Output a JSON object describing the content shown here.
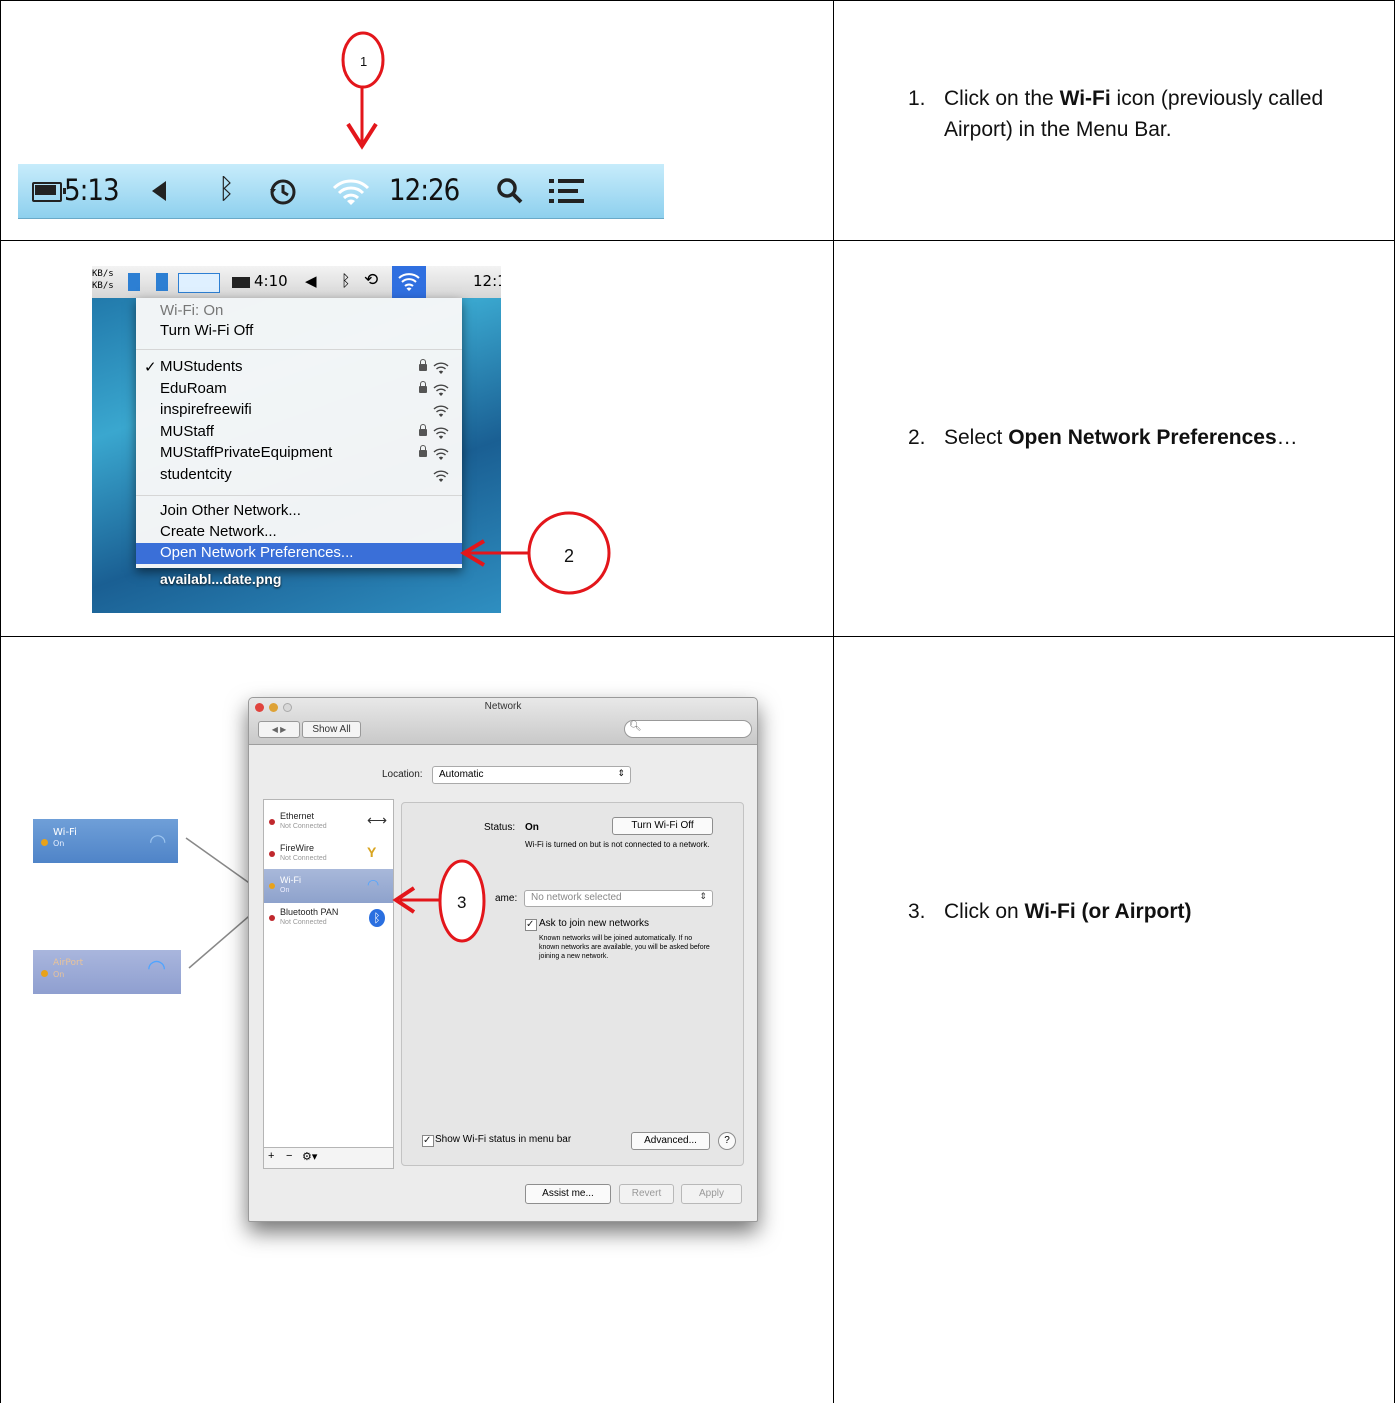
{
  "steps": [
    {
      "num": "1.",
      "pre": "Click on the ",
      "bold": "Wi-Fi",
      "post": " icon (previously called Airport) in the Menu Bar."
    },
    {
      "num": "2.",
      "pre": "Select ",
      "bold": "Open Network Preferences",
      "post": "…"
    },
    {
      "num": "3.",
      "pre": "Click on ",
      "bold": "Wi-Fi (or Airport)",
      "post": ""
    }
  ],
  "callouts": {
    "one": "1",
    "two": "2",
    "three": "3"
  },
  "menubar1": {
    "battery_time": "5:13",
    "clock": "12:26"
  },
  "menubar2": {
    "kb1": "KB/s",
    "kb2": "KB/s",
    "battery_time": "4:10",
    "clock": "12:1"
  },
  "wifi_menu": {
    "status": "Wi-Fi: On",
    "turn_off": "Turn Wi-Fi Off",
    "networks": [
      {
        "name": "MUStudents",
        "check": "✓",
        "lock": true
      },
      {
        "name": "EduRoam",
        "check": "",
        "lock": true
      },
      {
        "name": "inspirefreewifi",
        "check": "",
        "lock": false
      },
      {
        "name": "MUStaff",
        "check": "",
        "lock": true
      },
      {
        "name": "MUStaffPrivateEquipment",
        "check": "",
        "lock": true
      },
      {
        "name": "studentcity",
        "check": "",
        "lock": false
      }
    ],
    "join_other": "Join Other Network...",
    "create": "Create Network...",
    "open_prefs": "Open Network Preferences...",
    "desktop_file": "availabl...date.png"
  },
  "network_window": {
    "title": "Network",
    "show_all": "Show All",
    "location_label": "Location:",
    "location_value": "Automatic",
    "services": [
      {
        "name": "Ethernet",
        "status": "Not Connected",
        "dot": "#c0282d"
      },
      {
        "name": "FireWire",
        "status": "Not Connected",
        "dot": "#c0282d"
      },
      {
        "name": "Wi-Fi",
        "status": "On",
        "dot": "#e8a21a"
      },
      {
        "name": "Bluetooth PAN",
        "status": "Not Connected",
        "dot": "#c0282d"
      }
    ],
    "status_label": "Status:",
    "status_value": "On",
    "turn_off_button": "Turn Wi-Fi Off",
    "status_desc": "Wi-Fi is turned on but is not connected to a network.",
    "name_label": "ame:",
    "network_select": "No network selected",
    "ask_join": "Ask to join new networks",
    "ask_desc": "Known networks will be joined automatically. If no known networks are available, you will be asked before joining a new network.",
    "show_status": "Show Wi-Fi status in menu bar",
    "advanced": "Advanced...",
    "help": "?",
    "assist": "Assist me...",
    "revert": "Revert",
    "apply": "Apply"
  },
  "side_items": [
    {
      "name": "Wi-Fi",
      "status": "On"
    },
    {
      "name": "AirPort",
      "status": "On"
    }
  ],
  "colors": {
    "callout_red": "#e3161b",
    "menu_highlight": "#3a6fd8",
    "menubar_blue": "#a9d9f2"
  }
}
